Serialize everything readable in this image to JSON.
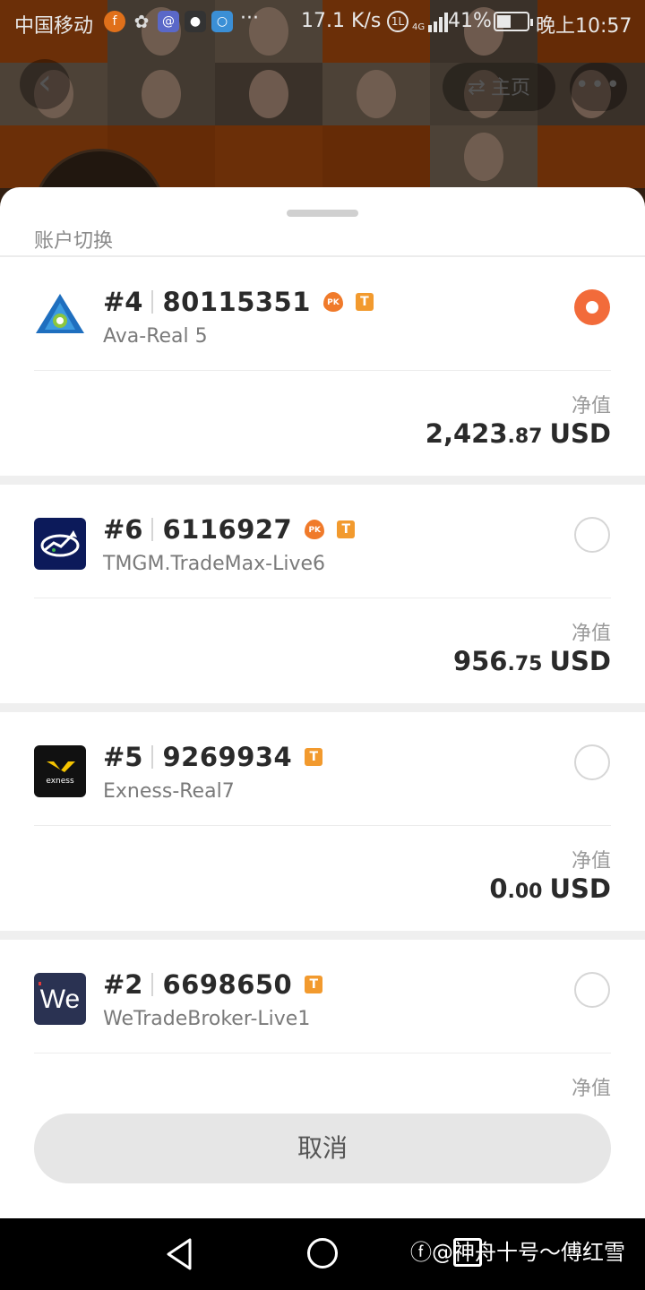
{
  "status_bar": {
    "carrier": "中国移动",
    "more": "···",
    "speed": "17.1 K/s",
    "network_badge": "1L",
    "signal_label": "4G",
    "battery": "41%",
    "battery_level": 0.41,
    "time": "晚上10:57"
  },
  "background_page": {
    "home_label": "主页"
  },
  "sheet": {
    "title": "账户切换",
    "equity_label": "净值",
    "cancel_label": "取消",
    "accounts": [
      {
        "index": "#4",
        "number": "80115351",
        "server": "Ava-Real 5",
        "pk": "PK",
        "badge": "T",
        "selected": true,
        "equity_int": "2,423",
        "equity_dec": ".87",
        "currency": "USD"
      },
      {
        "index": "#6",
        "number": "6116927",
        "server": "TMGM.TradeMax-Live6",
        "pk": "PK",
        "badge": "T",
        "selected": false,
        "equity_int": "956",
        "equity_dec": ".75",
        "currency": "USD"
      },
      {
        "index": "#5",
        "number": "9269934",
        "server": "Exness-Real7",
        "badge": "T",
        "logo_text": "exness",
        "selected": false,
        "equity_int": "0",
        "equity_dec": ".00",
        "currency": "USD"
      },
      {
        "index": "#2",
        "number": "6698650",
        "server": "WeTradeBroker-Live1",
        "badge": "T",
        "logo_text": "We",
        "selected": false
      }
    ]
  },
  "nav": {
    "watermark": "@神舟十号～傅红雪"
  }
}
